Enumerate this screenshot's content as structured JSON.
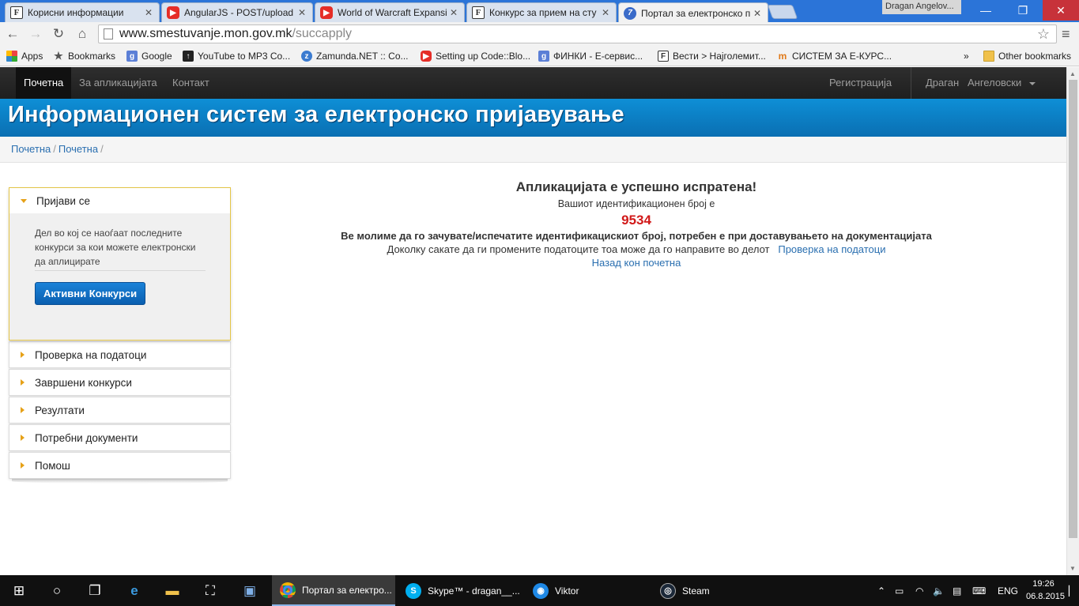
{
  "browser": {
    "tabs": [
      {
        "title": "Корисни информации",
        "icon": "f-icon"
      },
      {
        "title": "AngularJS - POST/upload",
        "icon": "youtube-icon"
      },
      {
        "title": "World of Warcraft Expansi",
        "icon": "youtube-icon"
      },
      {
        "title": "Конкурс за прием на сту",
        "icon": "f-icon"
      },
      {
        "title": "Портал за електронско п",
        "icon": "portal-icon"
      }
    ],
    "profile_name": "Dragan Angelov...",
    "url_host": "www.smestuvanje.mon.gov.mk",
    "url_path": "/succapply",
    "bookmarks": [
      {
        "label": "Apps",
        "icon": "apps-icon"
      },
      {
        "label": "Bookmarks",
        "icon": "star-icon"
      },
      {
        "label": "Google",
        "icon": "g-icon"
      },
      {
        "label": "YouTube to MP3 Co...",
        "icon": "download-icon"
      },
      {
        "label": "Zamunda.NET :: Co...",
        "icon": "zamunda-icon"
      },
      {
        "label": "Setting up Code::Blo...",
        "icon": "youtube-icon"
      },
      {
        "label": "ФИНКИ - Е-сервис...",
        "icon": "g-icon"
      },
      {
        "label": "Вести > Најголемит...",
        "icon": "vesti-icon"
      },
      {
        "label": "СИСТЕМ ЗА Е-КУРС...",
        "icon": "mn-icon"
      }
    ],
    "bookmarks_overflow": "»",
    "other_bookmarks": "Other bookmarks"
  },
  "site": {
    "nav": {
      "home": "Почетна",
      "about": "За апликацијата",
      "contact": "Контакт",
      "register": "Регистрација",
      "user_first": "Драган",
      "user_last": "Ангеловски"
    },
    "banner_title": "Информационен систем за електронско пријавување",
    "breadcrumb": [
      "Почетна",
      "Почетна"
    ],
    "sidebar": {
      "open_section": {
        "title": "Пријави се",
        "description": "Дел во кој се наоѓаат последните конкурси за кои можете електронски да аплицирате",
        "button": "Активни Конкурси"
      },
      "sections": [
        "Проверка на податоци",
        "Завршени конкурси",
        "Резултати",
        "Потребни документи",
        "Помош"
      ]
    },
    "main": {
      "title": "Апликацијата е успешно испратена!",
      "id_label": "Вашиот идентификационен број е",
      "id_number": "9534",
      "notice": "Ве молиме да го зачувате/испечатите идентификацискиот број, потребен е при доставувањето на документацијата",
      "change_text": "Доколку сакате да ги промените податоците тоа може да го направите во делот",
      "change_link": "Проверка на податоци",
      "back_link": "Назад кон почетна"
    }
  },
  "taskbar": {
    "apps": [
      {
        "label": "Портал за електро...",
        "icon": "chrome-icon",
        "active": true
      },
      {
        "label": "Skype™ - dragan__...",
        "icon": "skype-icon",
        "active": false
      },
      {
        "label": "Viktor",
        "icon": "viktor-icon",
        "active": false
      },
      {
        "label": "Steam",
        "icon": "steam-icon",
        "active": false
      }
    ],
    "language": "ENG",
    "time": "19:26",
    "date": "06.8.2015"
  },
  "colors": {
    "banner": "#0a7cc4",
    "nav_bg": "#222222",
    "link": "#2a6fb0",
    "id_number": "#d11919",
    "button": "#0a6fc4",
    "accordion_arrow": "#e6a118"
  }
}
